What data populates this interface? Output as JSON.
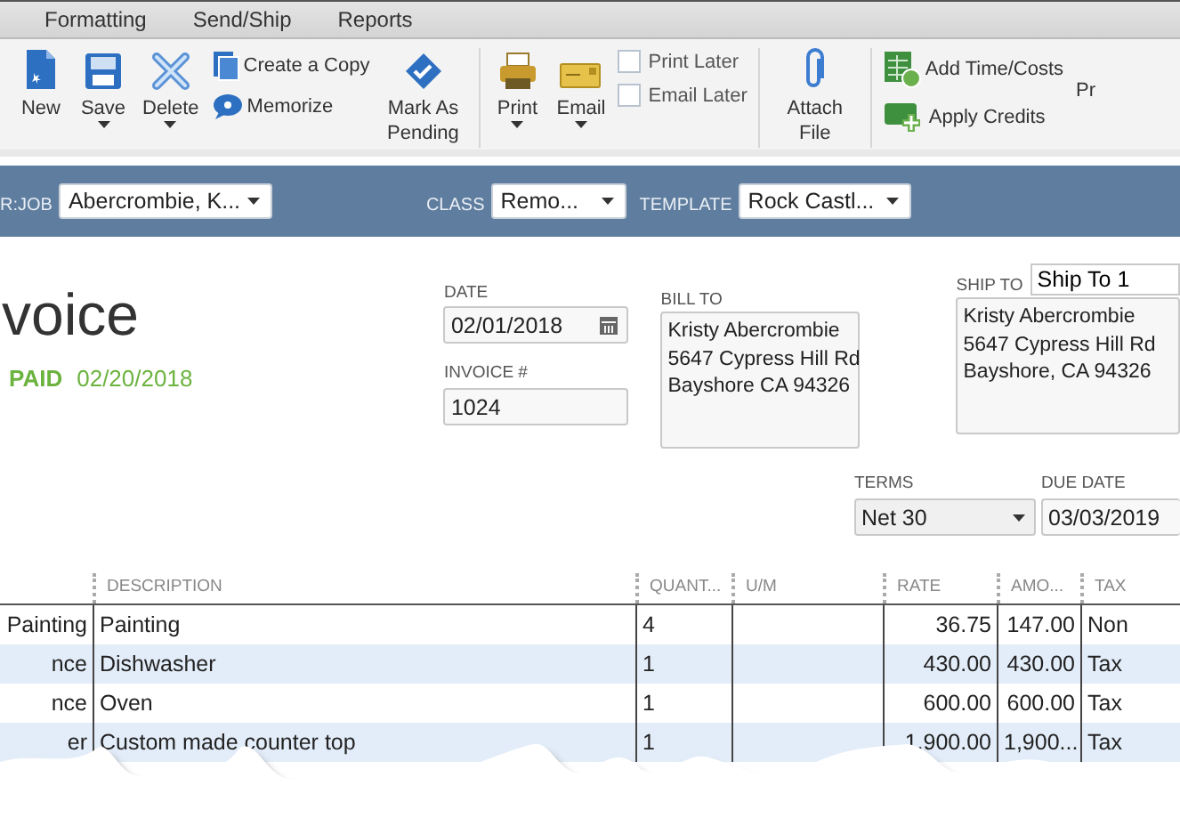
{
  "menu": [
    {
      "label": "Formatting"
    },
    {
      "label": "Send/Ship"
    },
    {
      "label": "Reports"
    }
  ],
  "toolbar": {
    "groups": [
      [
        {
          "kind": "big",
          "label": "New",
          "dropdown": false
        },
        {
          "kind": "big",
          "label": "Save",
          "dropdown": true
        },
        {
          "kind": "big",
          "label": "Delete",
          "dropdown": true
        },
        {
          "kind": "stack",
          "items": [
            {
              "kind": "small",
              "label": "Create a Copy"
            },
            {
              "kind": "small",
              "label": "Memorize"
            }
          ]
        },
        {
          "kind": "big",
          "label": "Mark As Pending",
          "dropdown": false
        }
      ],
      [
        {
          "kind": "big",
          "label": "Print",
          "dropdown": true
        },
        {
          "kind": "big",
          "label": "Email",
          "dropdown": true
        },
        {
          "kind": "stack",
          "items": [
            {
              "kind": "check",
              "label": "Print Later",
              "checked": false
            },
            {
              "kind": "check",
              "label": "Email Later",
              "checked": false
            }
          ]
        }
      ],
      [
        {
          "kind": "big",
          "label": "Attach File",
          "dropdown": false
        }
      ],
      [
        {
          "kind": "stack",
          "items": [
            {
              "kind": "small",
              "label": "Add Time/Costs"
            },
            {
              "kind": "small",
              "label": "Apply Credits"
            }
          ]
        },
        {
          "kind": "cut",
          "label": "Pr"
        }
      ]
    ]
  },
  "header_bar": [
    {
      "label": "R:JOB",
      "value": "Abercrombie, K..."
    },
    {
      "label": "CLASS",
      "value": "Remo..."
    },
    {
      "label": "TEMPLATE",
      "value": "Rock Castl..."
    }
  ],
  "form": {
    "title": "voice",
    "status": "PAID",
    "status_date": "02/20/2018",
    "date": {
      "label": "DATE",
      "value": "02/01/2018"
    },
    "invoice_number": {
      "label": "INVOICE #",
      "value": "1024"
    },
    "bill_to": {
      "label": "BILL TO",
      "lines": [
        "Kristy Abercrombie",
        "5647 Cypress Hill Rd",
        "Bayshore CA 94326"
      ]
    },
    "ship_to": {
      "label": "SHIP TO",
      "selector": "Ship To 1",
      "lines": [
        "Kristy Abercrombie",
        "5647 Cypress Hill Rd",
        "Bayshore, CA 94326"
      ]
    },
    "terms": {
      "label": "TERMS",
      "value": "Net 30"
    },
    "due_date": {
      "label": "DUE DATE",
      "value": "03/03/2019"
    }
  },
  "table": {
    "columns": [
      "DESCRIPTION",
      "QUANT...",
      "U/M",
      "RATE",
      "AMO...",
      "TAX"
    ],
    "rows": [
      {
        "column_1": "Painting",
        "description": "Painting",
        "quantity": "4",
        "rate": "36.75",
        "amount": "147.00",
        "tax": "Non"
      },
      {
        "column_1": "nce",
        "description": "Dishwasher",
        "quantity": "1",
        "rate": "430.00",
        "amount": "430.00",
        "tax": "Tax"
      },
      {
        "column_1": "nce",
        "description": "Oven",
        "quantity": "1",
        "rate": "600.00",
        "amount": "600.00",
        "tax": "Tax"
      },
      {
        "column_1": "er",
        "description": "Custom made counter top",
        "quantity": "1",
        "rate": "1,900.00",
        "amount": "1,900...",
        "tax": "Tax"
      }
    ]
  }
}
